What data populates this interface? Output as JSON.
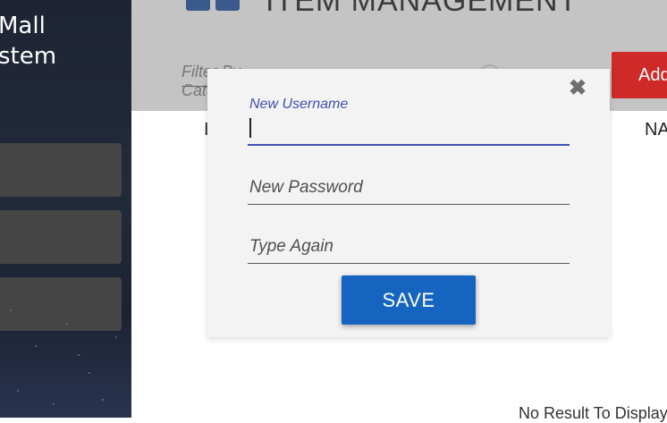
{
  "sidebar": {
    "app_title": "Mall\nstem",
    "nav_items": [
      "",
      "",
      ""
    ]
  },
  "header": {
    "title": "ITEM MANAGEMENT",
    "filter_placeholder": "Filter By Category",
    "add_button_label": "Add"
  },
  "table": {
    "first_column_partial": "I",
    "right_column_partial": "NA",
    "empty_message": "No Result To Display"
  },
  "modal": {
    "username": {
      "label": "New Username",
      "value": ""
    },
    "password": {
      "placeholder": "New Password"
    },
    "confirm": {
      "placeholder": "Type Again"
    },
    "save_label": "SAVE",
    "close_glyph": "✖"
  },
  "colors": {
    "accent": "#3f51b5",
    "save": "#1565c0",
    "add": "#cf2a27"
  }
}
